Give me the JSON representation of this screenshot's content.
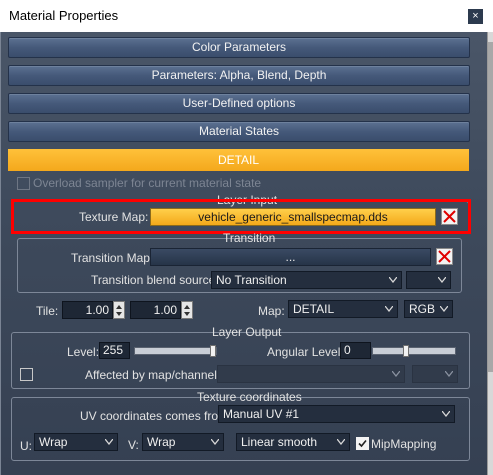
{
  "window": {
    "title": "Material Properties",
    "close_glyph": "×"
  },
  "sections": {
    "color": "Color Parameters",
    "params": "Parameters: Alpha, Blend, Depth",
    "user": "User-Defined options",
    "states": "Material States",
    "detail": "DETAIL"
  },
  "overload": {
    "label": "Overload sampler for current material state",
    "checked": false
  },
  "layer_input": {
    "title": "Layer Input",
    "texture_label": "Texture Map:",
    "texture_value": "vehicle_generic_smallspecmap.dds"
  },
  "transition": {
    "title": "Transition",
    "map_label": "Transition Map:",
    "map_value": "...",
    "blend_label": "Transition blend source:",
    "blend_value": "No Transition"
  },
  "tile": {
    "label": "Tile:",
    "u": "1.00",
    "v": "1.00",
    "map_label": "Map:",
    "map_value": "DETAIL",
    "channel_value": "RGB"
  },
  "layer_output": {
    "title": "Layer Output",
    "level_label": "Level:",
    "level_value": "255",
    "angular_label": "Angular Level:",
    "angular_value": "0",
    "affected_label": "Affected by map/channel:"
  },
  "texcoords": {
    "title": "Texture coordinates",
    "uv_label": "UV coordinates comes from:",
    "uv_value": "Manual UV #1",
    "u_label": "U:",
    "u_value": "Wrap",
    "v_label": "V:",
    "v_value": "Wrap",
    "filter_value": "Linear smooth",
    "mip_label": "MipMapping",
    "mip_checked": true
  },
  "colors": {
    "accent": "#f4a81c",
    "highlight": "#ff0000",
    "section": "#45597a"
  }
}
